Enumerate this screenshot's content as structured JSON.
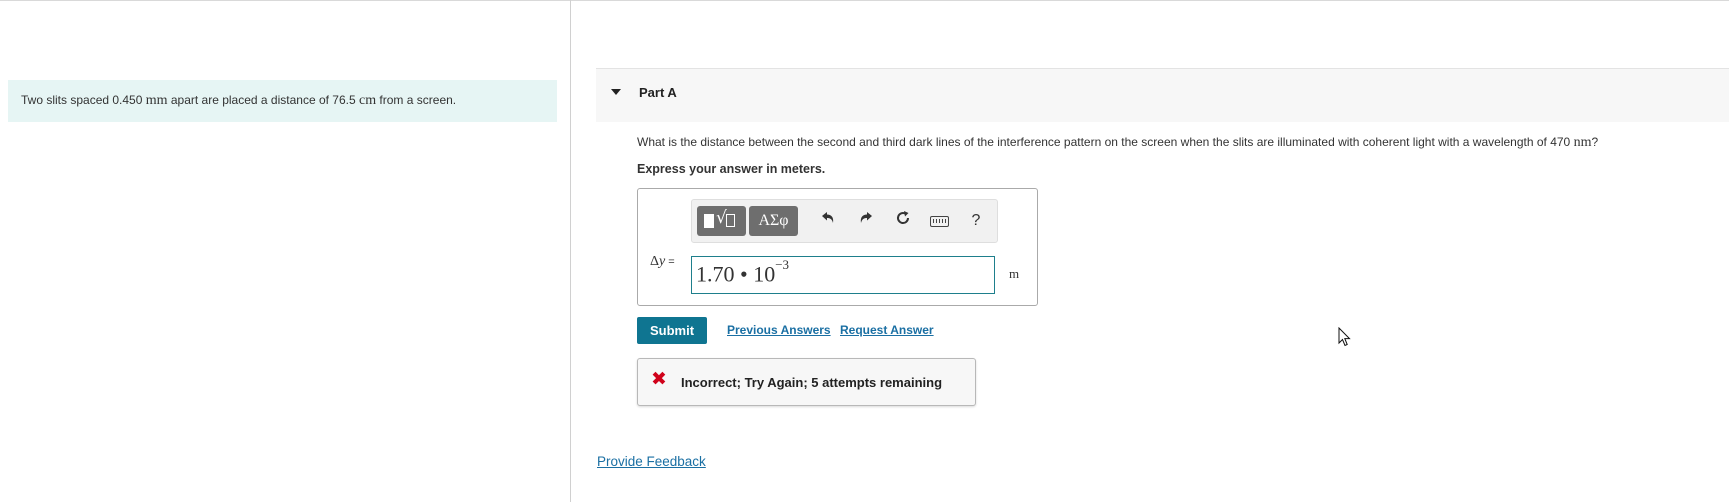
{
  "problem": {
    "text_1": "Two slits spaced 0.450 ",
    "unit_1": "mm",
    "text_2": " apart are placed a distance of 76.5 ",
    "unit_2": "cm",
    "text_3": " from a screen."
  },
  "part": {
    "title": "Part A",
    "question_text": "What is the distance between the second and third dark lines of the interference pattern on the screen when the slits are illuminated with coherent light with a wavelength of 470 ",
    "question_unit": "nm",
    "question_end": "?",
    "instruction": "Express your answer in meters."
  },
  "toolbar": {
    "greek_label": "ΑΣφ",
    "help_label": "?"
  },
  "answer": {
    "variable_symbol": "Δ",
    "variable_letter": "y",
    "equals": " =",
    "value_base": "1.70 • 10",
    "value_exponent": "−3",
    "unit": "m"
  },
  "actions": {
    "submit_label": "Submit",
    "previous_answers": "Previous Answers",
    "request_answer": "Request Answer"
  },
  "feedback": {
    "message": "Incorrect; Try Again; 5 attempts remaining",
    "icon": "x-mark-icon",
    "color": "#d0021b"
  },
  "footer": {
    "provide_feedback": "Provide Feedback"
  },
  "colors": {
    "accent": "#0f7591",
    "problem_bg": "#e6f5f4",
    "link": "#1a6fa3"
  }
}
